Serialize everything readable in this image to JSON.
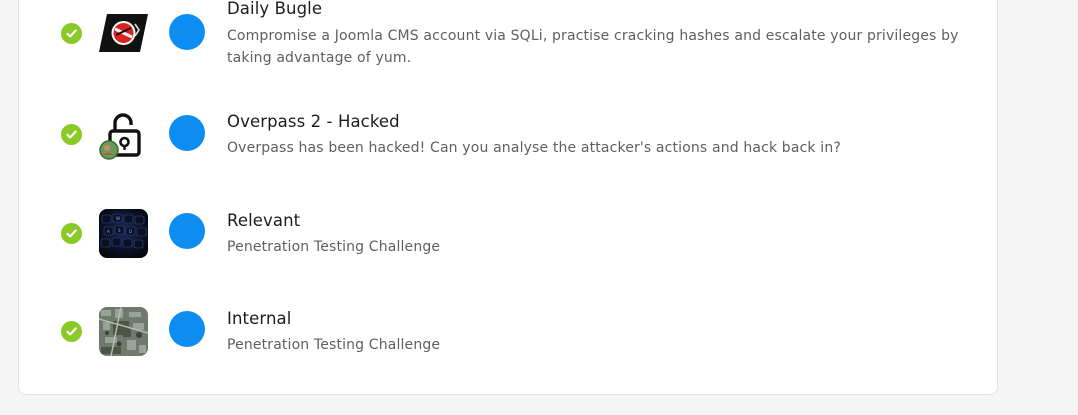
{
  "colors": {
    "check_green": "#8ac926",
    "dot_blue": "#0d8cf2",
    "card_border": "#e2e2e2"
  },
  "rooms": [
    {
      "title": "Daily Bugle",
      "description": "Compromise a Joomla CMS account via SQLi, practise cracking hashes and escalate your privileges by taking advantage of yum.",
      "icon": "daily-bugle-logo-icon",
      "completed": true
    },
    {
      "title": "Overpass 2 - Hacked",
      "description": "Overpass has been hacked! Can you analyse the attacker's actions and hack back in?",
      "icon": "overpass-padlock-icon",
      "completed": true
    },
    {
      "title": "Relevant",
      "description": "Penetration Testing Challenge",
      "icon": "relevant-keyboard-icon",
      "completed": true
    },
    {
      "title": "Internal",
      "description": "Penetration Testing Challenge",
      "icon": "internal-aerial-icon",
      "completed": true
    }
  ]
}
